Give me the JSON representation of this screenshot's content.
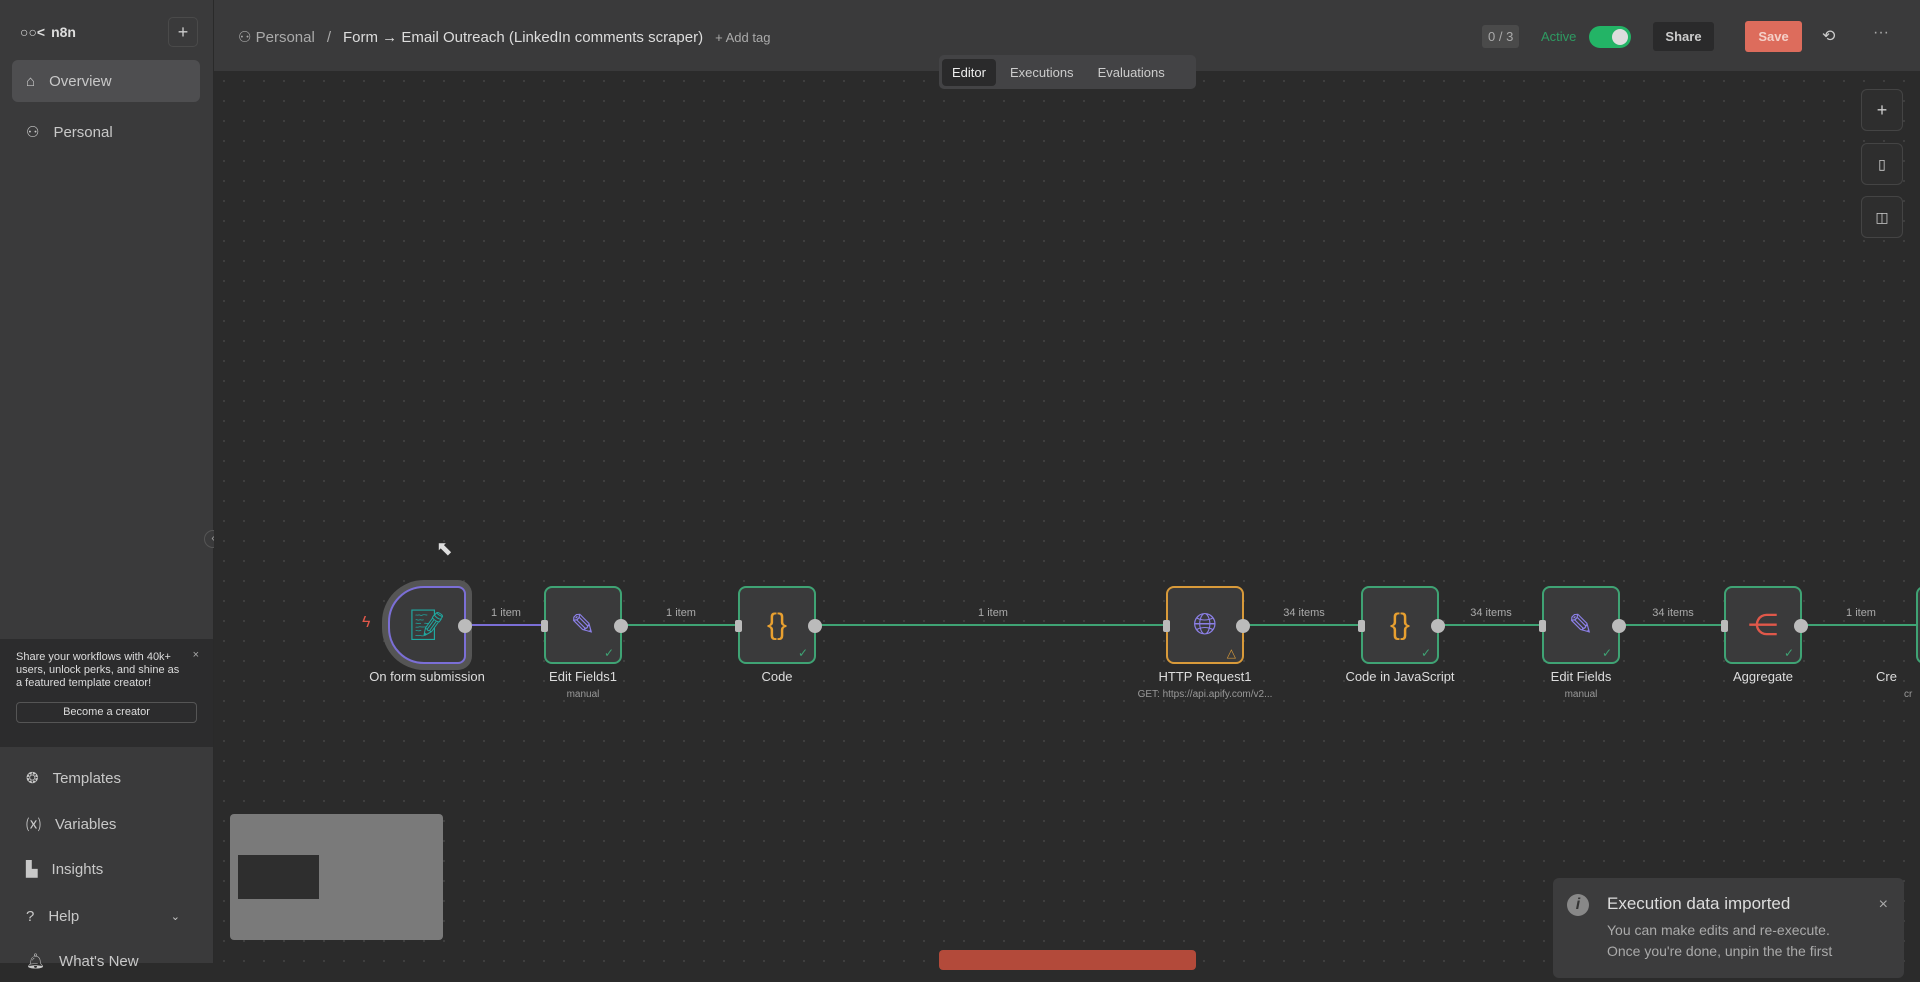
{
  "app": {
    "logo": "n8n"
  },
  "sidebar": {
    "items": [
      {
        "label": "Overview",
        "icon": "home-icon"
      },
      {
        "label": "Personal",
        "icon": "user-icon"
      }
    ],
    "promo": {
      "text": "Share your workflows with 40k+ users, unlock perks, and shine as a featured template creator!",
      "button": "Become a creator"
    },
    "bottom": [
      {
        "label": "Templates"
      },
      {
        "label": "Variables"
      },
      {
        "label": "Insights"
      },
      {
        "label": "Help"
      },
      {
        "label": "What's New"
      }
    ]
  },
  "header": {
    "project": "Personal",
    "title": "Form → Email Outreach (LinkedIn comments scraper)",
    "add_tag": "+ Add tag",
    "counter": "0 / 3",
    "active_label": "Active",
    "active": true,
    "share": "Share",
    "save": "Save"
  },
  "tabs": [
    "Editor",
    "Executions",
    "Evaluations"
  ],
  "nodes": [
    {
      "name": "On form submission",
      "sub": ""
    },
    {
      "name": "Edit Fields1",
      "sub": "manual"
    },
    {
      "name": "Code",
      "sub": ""
    },
    {
      "name": "HTTP Request1",
      "sub": "GET: https://api.apify.com/v2..."
    },
    {
      "name": "Code in JavaScript",
      "sub": ""
    },
    {
      "name": "Edit Fields",
      "sub": "manual"
    },
    {
      "name": "Aggregate",
      "sub": ""
    },
    {
      "name": "Cre",
      "sub": "cr"
    }
  ],
  "edges": [
    "1 item",
    "1 item",
    "1 item",
    "34 items",
    "34 items",
    "34 items",
    "1 item"
  ],
  "toast": {
    "title": "Execution data imported",
    "body1": "You can make edits and re-execute.",
    "body2": "Once you're done, unpin the the first"
  },
  "colors": {
    "success": "#3fa374",
    "accent": "#dd6c5c",
    "warning": "#e0a030"
  }
}
